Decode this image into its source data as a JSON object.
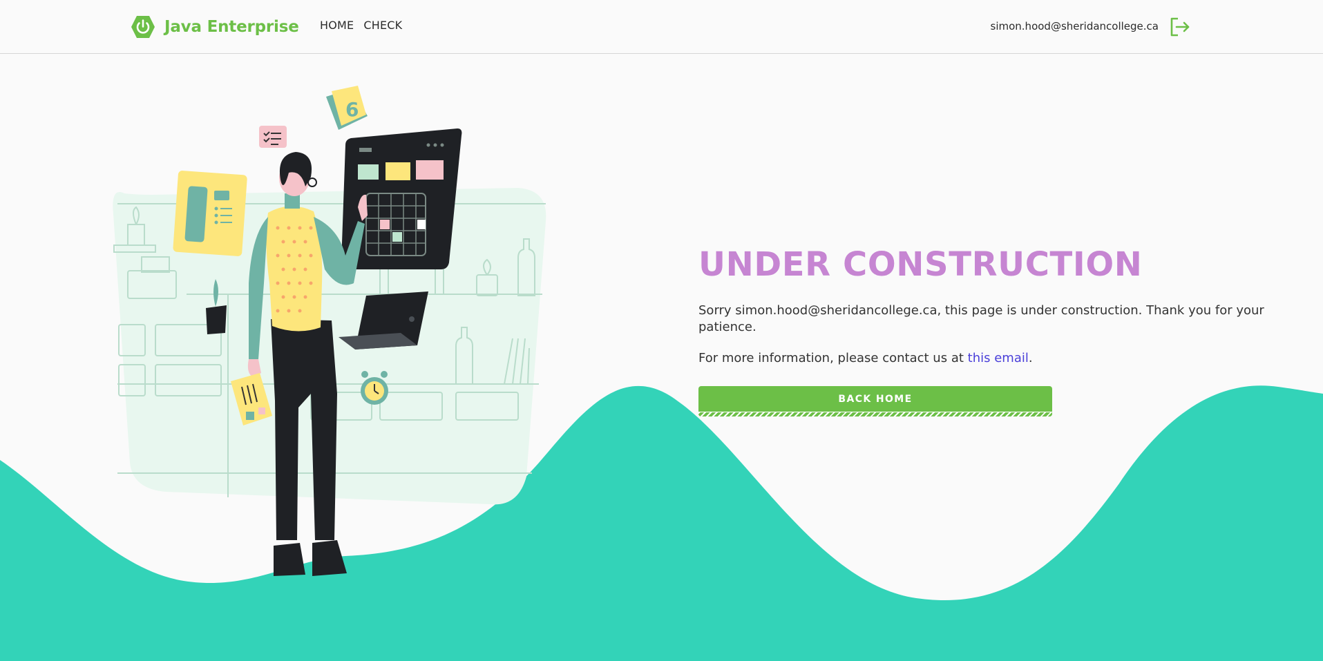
{
  "header": {
    "brand_name": "Java Enterprise",
    "nav": [
      {
        "label": "HOME"
      },
      {
        "label": "CHECK"
      }
    ],
    "user_email": "simon.hood@sheridancollege.ca",
    "logout_icon": "logout-icon"
  },
  "main": {
    "title": "UNDER CONSTRUCTION",
    "message_line1": "Sorry simon.hood@sheridancollege.ca, this page is under construction. Thank you for your patience.",
    "message_line2_prefix": "For more information, please contact us at ",
    "contact_link": "this email",
    "message_line2_suffix": ".",
    "back_button": "BACK HOME",
    "illustration_number": "6"
  },
  "colors": {
    "brand_green": "#6cbf47",
    "title_purple": "#c685d2",
    "wave_teal": "#33d3b8",
    "link_blue": "#4a3fd9"
  }
}
